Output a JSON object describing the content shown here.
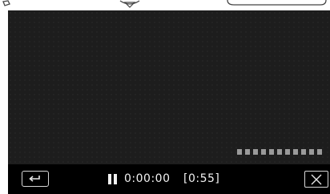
{
  "player": {
    "elapsed_time": "0:00:00",
    "total_time": "[0:55]",
    "progress_segments": 11
  },
  "icons": {
    "back": "return-arrow-icon",
    "pause": "pause-icon",
    "close": "close-icon"
  },
  "colors": {
    "screen_bg": "#1e1e1e",
    "bar_bg": "#000000",
    "text": "#f2f2f2",
    "dots": "#9a9a9a"
  }
}
